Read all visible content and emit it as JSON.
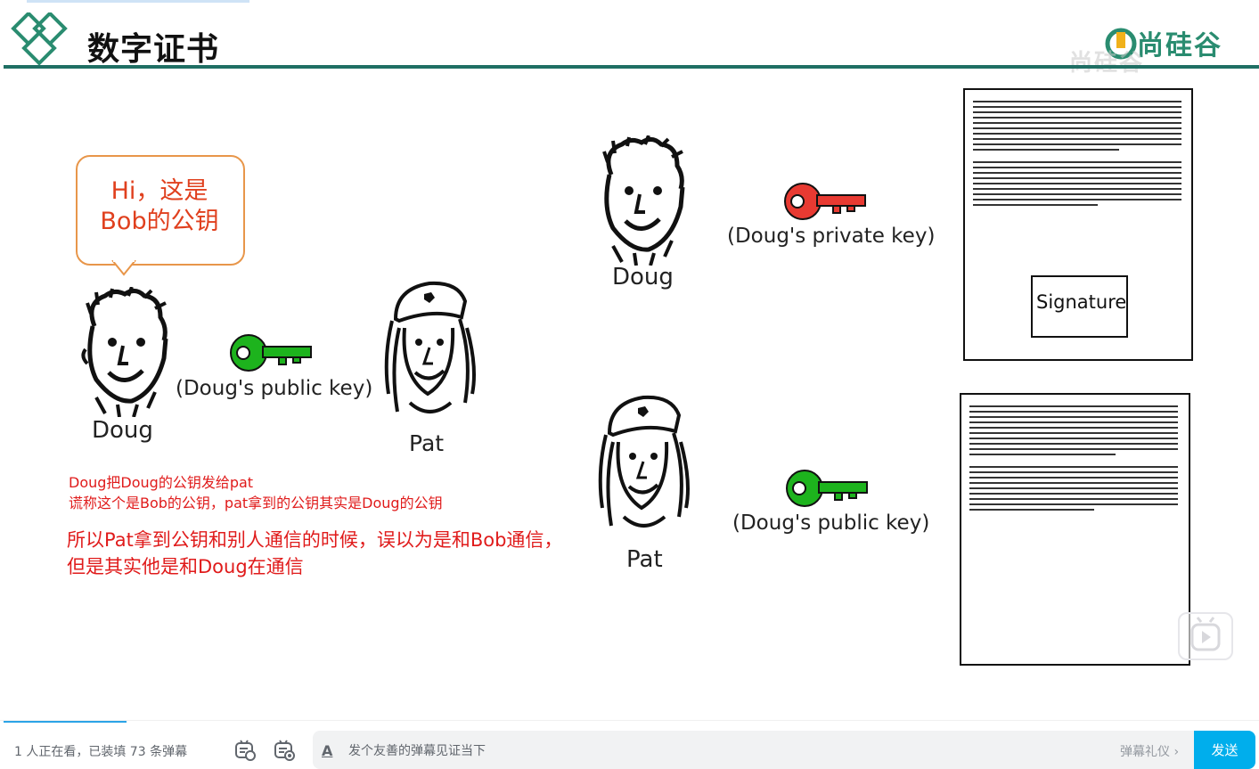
{
  "slide": {
    "title": "数字证书",
    "brand": "尚硅谷",
    "watermark": "尚硅谷",
    "bubble_line1": "Hi，这是",
    "bubble_line2": "Bob的公钥",
    "left": {
      "doug_label": "Doug",
      "pat_label": "Pat",
      "key_label": "(Doug's public key)",
      "key_color": "#1db31d"
    },
    "right_top": {
      "doug_label": "Doug",
      "key_label": "(Doug's private key)",
      "key_color": "#e83a32",
      "signature_label": "Signature"
    },
    "right_bottom": {
      "pat_label": "Pat",
      "key_label": "(Doug's public key)",
      "key_color": "#1db31d"
    },
    "notes": {
      "line1": "Doug把Doug的公钥发给pat",
      "line2": "谎称这个是Bob的公钥，pat拿到的公钥其实是Doug的公钥",
      "line3": "所以Pat拿到公钥和别人通信的时候，误以为是和Bob通信，",
      "line4": "但是其实他是和Doug在通信"
    }
  },
  "player": {
    "play_icon": "play-icon"
  },
  "bottom_bar": {
    "viewer_text": "1 人正在看，已装填 73 条弹幕",
    "danmaku_placeholder": "发个友善的弹幕见证当下",
    "etiquette_label": "弹幕礼仪 ›",
    "send_label": "发送",
    "text_style_icon": "A"
  }
}
